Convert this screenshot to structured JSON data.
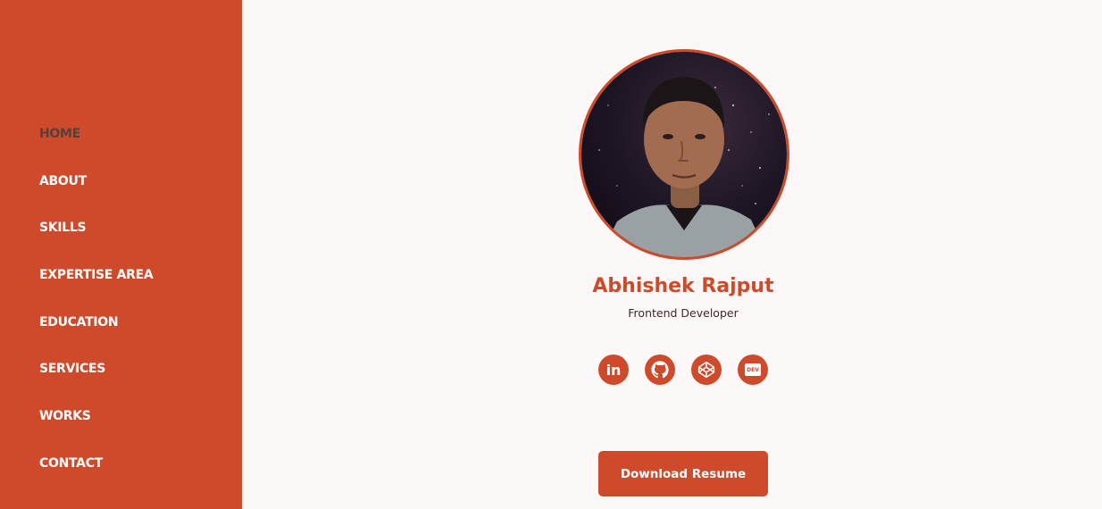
{
  "nav": {
    "items": [
      {
        "label": "HOME",
        "active": true
      },
      {
        "label": "ABOUT"
      },
      {
        "label": "SKILLS"
      },
      {
        "label": "EXPERTISE AREA"
      },
      {
        "label": "EDUCATION"
      },
      {
        "label": "SERVICES"
      },
      {
        "label": "WORKS"
      },
      {
        "label": "CONTACT"
      }
    ]
  },
  "profile": {
    "name": "Abhishek Rajput",
    "role": "Frontend Developer"
  },
  "socials": [
    {
      "icon": "linkedin-icon",
      "glyph": "in"
    },
    {
      "icon": "github-icon"
    },
    {
      "icon": "codepen-icon"
    },
    {
      "icon": "devto-icon",
      "glyph": "DEV"
    }
  ],
  "actions": {
    "download_label": "Download Resume"
  },
  "colors": {
    "accent": "#cf4a2b",
    "active_nav": "#5a3f38",
    "background": "#fcf8f7"
  }
}
